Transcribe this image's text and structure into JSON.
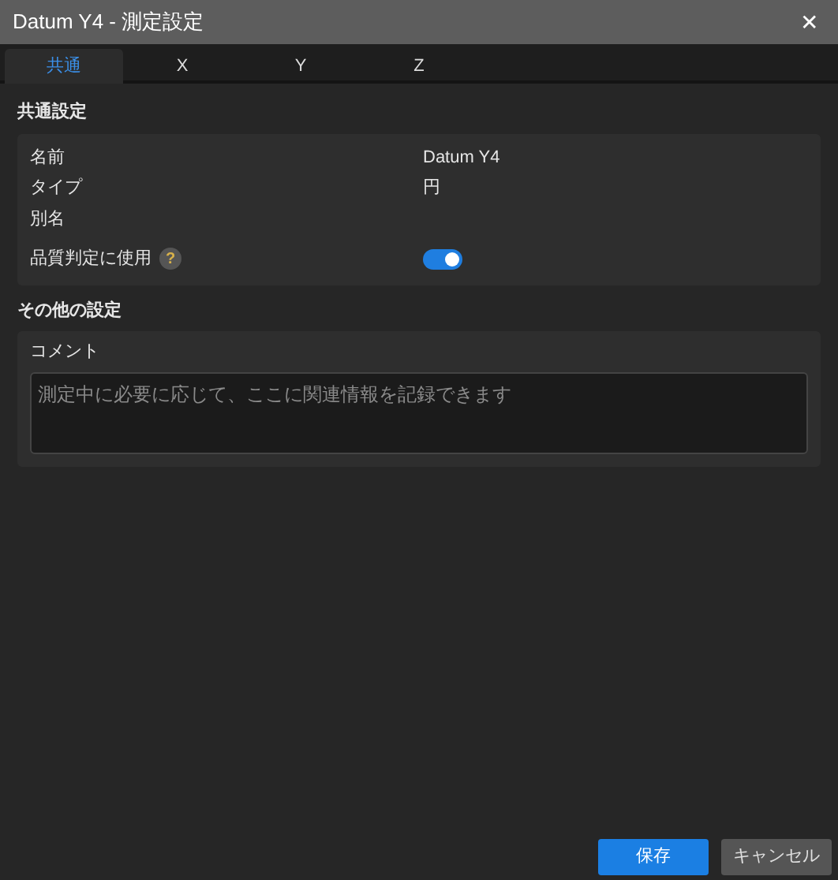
{
  "window": {
    "title": "Datum Y4 - 測定設定",
    "close": "✕"
  },
  "tabs": [
    {
      "label": "共通",
      "selected": true
    },
    {
      "label": "X",
      "selected": false
    },
    {
      "label": "Y",
      "selected": false
    },
    {
      "label": "Z",
      "selected": false
    }
  ],
  "common_settings": {
    "heading": "共通設定",
    "rows": [
      {
        "kind": "text",
        "label": "名前",
        "value": "Datum Y4"
      },
      {
        "kind": "text",
        "label": "タイプ",
        "value": "円"
      },
      {
        "kind": "text",
        "label": "別名"
      },
      {
        "kind": "toggle",
        "label": "品質判定に使用",
        "help": "?",
        "on": true
      }
    ]
  },
  "other_settings": {
    "heading": "その他の設定",
    "comment": {
      "label": "コメント",
      "placeholder": "測定中に必要に応じて、ここに関連情報を記録できます"
    }
  },
  "buttons": [
    {
      "kind": "primary",
      "label": "保存"
    },
    {
      "kind": "secondary",
      "label": "キャンセル"
    }
  ]
}
